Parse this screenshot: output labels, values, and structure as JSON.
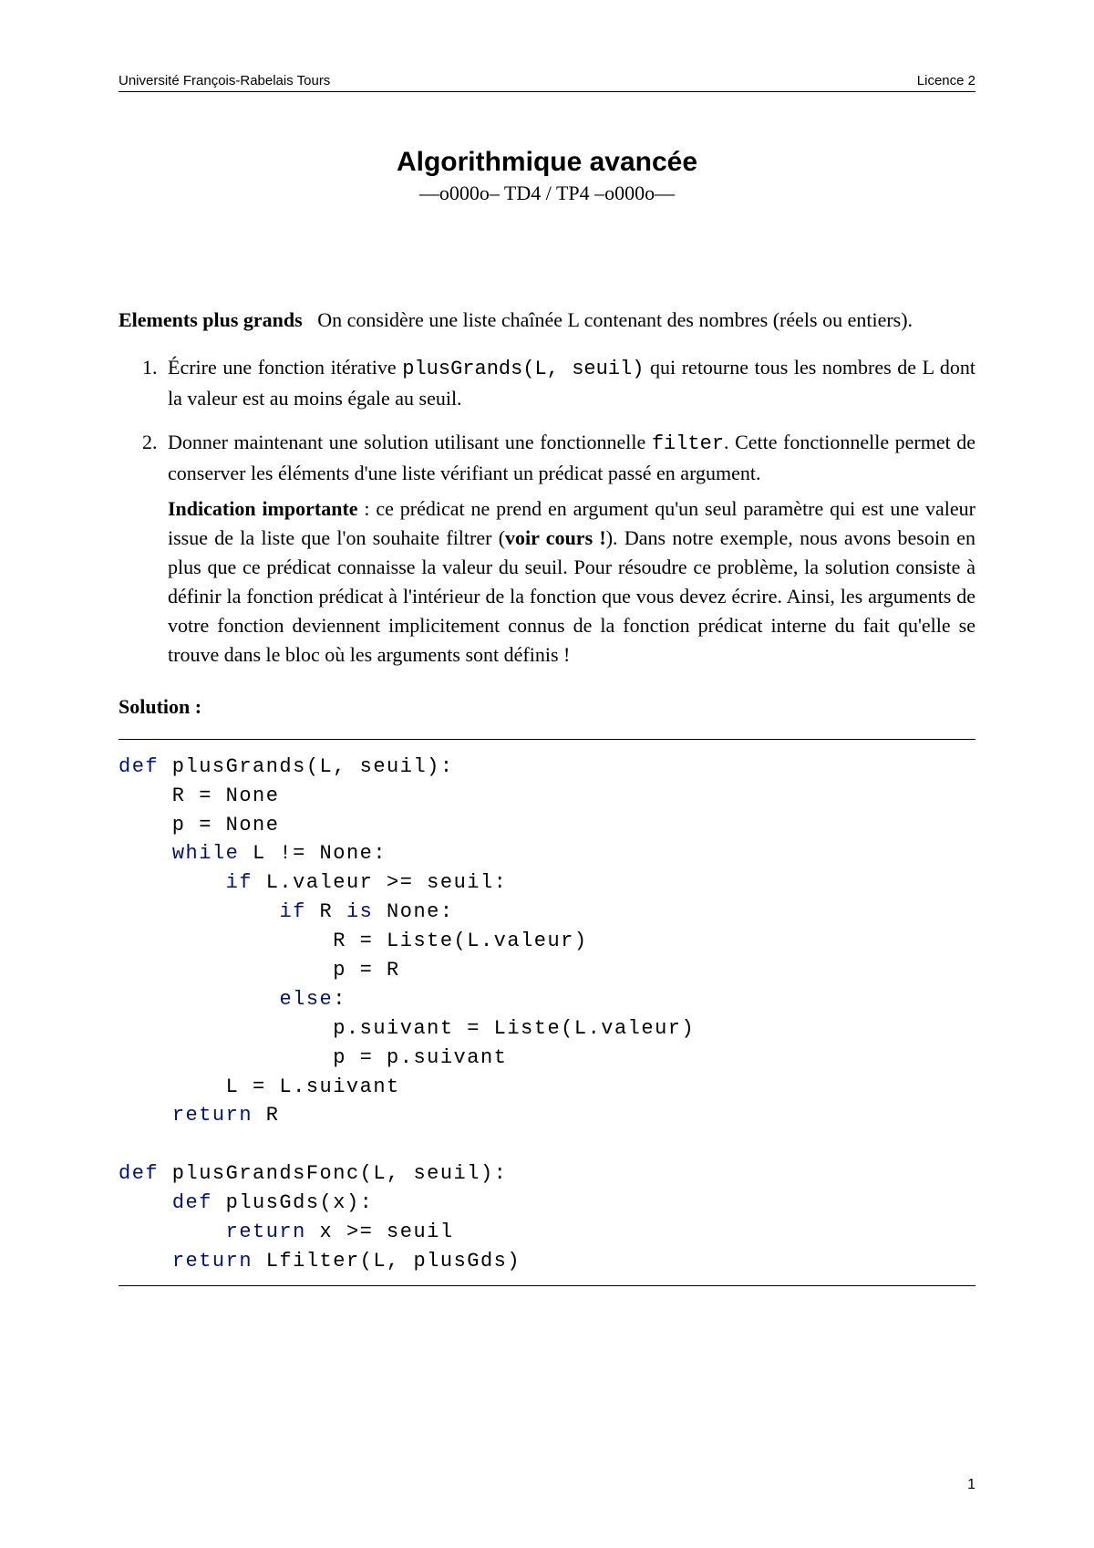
{
  "header": {
    "left": "Université François-Rabelais Tours",
    "right": "Licence 2"
  },
  "title": "Algorithmique avancée",
  "subtitle": "—o000o– TD4 / TP4 –o000o—",
  "intro_label": "Elements plus grands",
  "intro_text": "On considère une liste chaînée L contenant des nombres (réels ou entiers).",
  "items": {
    "1": {
      "prefix": "Écrire une fonction itérative ",
      "code": "plusGrands(L, seuil)",
      "suffix": " qui retourne tous les nombres de L dont la valeur est au moins égale au seuil."
    },
    "2": {
      "p1a": "Donner maintenant une solution utilisant une fonctionnelle ",
      "p1code": "filter",
      "p1b": ". Cette fonc­tionnelle permet de conserver les éléments d'une liste vérifiant un prédicat passé en argument.",
      "p2_label": "Indication importante",
      "p2a": " : ce prédicat ne prend en argument qu'un seul paramètre qui est une valeur issue de la liste que l'on souhaite filtrer (",
      "p2_bold": "voir cours !",
      "p2b": "). Dans notre exemple, nous avons besoin en plus que ce prédicat connaisse la valeur du seuil. Pour résoudre ce problème, la solution consiste à définir la fonction prédicat à l'intérieur de la fonction que vous devez écrire. Ainsi, les arguments de votre fonction deviennent implicitement connus de la fonction prédicat interne du fait qu'elle se trouve dans le bloc où les arguments sont définis !"
    }
  },
  "solution_label": "Solution :",
  "code": {
    "l01a": "def",
    "l01b": " plusGrands(L, seuil):",
    "l02": "    R = None",
    "l03": "    p = None",
    "l04a": "    ",
    "l04b": "while",
    "l04c": " L != None:",
    "l05a": "        ",
    "l05b": "if",
    "l05c": " L.valeur >= seuil:",
    "l06a": "            ",
    "l06b": "if",
    "l06c": " R ",
    "l06d": "is",
    "l06e": " None:",
    "l07": "                R = Liste(L.valeur)",
    "l08": "                p = R",
    "l09a": "            ",
    "l09b": "else",
    "l09c": ":",
    "l10": "                p.suivant = Liste(L.valeur)",
    "l11": "                p = p.suivant",
    "l12": "        L = L.suivant",
    "l13a": "    ",
    "l13b": "return",
    "l13c": " R",
    "l14": "",
    "l15a": "def",
    "l15b": " plusGrandsFonc(L, seuil):",
    "l16a": "    ",
    "l16b": "def",
    "l16c": " plusGds(x):",
    "l17a": "        ",
    "l17b": "return",
    "l17c": " x >= seuil",
    "l18a": "    ",
    "l18b": "return",
    "l18c": " Lfilter(L, plusGds)"
  },
  "page_number": "1"
}
